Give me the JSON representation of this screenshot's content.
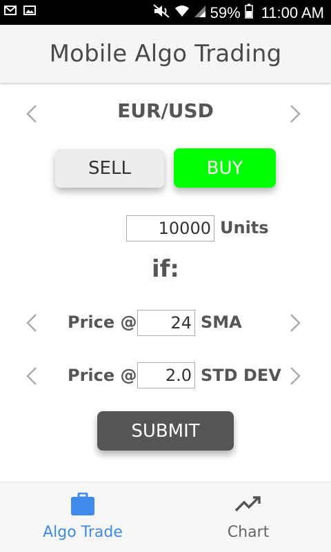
{
  "status_bar": {
    "battery": "59%",
    "time": "11:00 AM",
    "icons": [
      "mail-icon",
      "image-icon",
      "mute-icon",
      "wifi-icon",
      "signal-icon",
      "battery-icon"
    ]
  },
  "app_bar": {
    "title": "Mobile Algo Trading"
  },
  "instrument": {
    "pair": "EUR/USD"
  },
  "trade": {
    "sell_label": "SELL",
    "buy_label": "BUY",
    "buy_color": "#00ff00",
    "units_value": "10000",
    "units_label": "Units",
    "if_label": "if:"
  },
  "conditions": [
    {
      "prefix": "Price @",
      "value": "24",
      "suffix": "SMA"
    },
    {
      "prefix": "Price @",
      "value": "2.0",
      "suffix": "STD DEV"
    }
  ],
  "submit_label": "SUBMIT",
  "bottom_nav": {
    "active_color": "#3f8be9",
    "items": [
      {
        "label": "Algo Trade",
        "icon": "briefcase-icon"
      },
      {
        "label": "Chart",
        "icon": "trending-up-icon"
      }
    ]
  }
}
